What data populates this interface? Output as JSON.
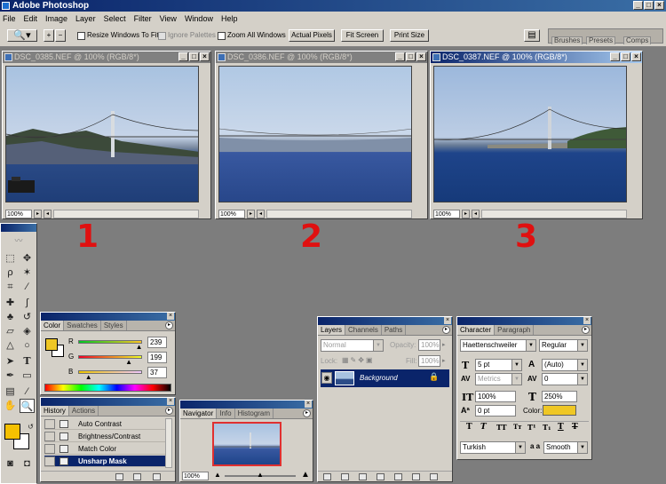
{
  "app": {
    "title": "Adobe Photoshop"
  },
  "menu": [
    "File",
    "Edit",
    "Image",
    "Layer",
    "Select",
    "Filter",
    "View",
    "Window",
    "Help"
  ],
  "options": {
    "resize_windows": "Resize Windows To Fit",
    "ignore_palettes": "Ignore Palettes",
    "zoom_all_windows": "Zoom All Windows",
    "actual_pixels": "Actual Pixels",
    "fit_screen": "Fit Screen",
    "print_size": "Print Size"
  },
  "palette_well": {
    "tabs": [
      "Brushes",
      "Presets",
      "Comps"
    ]
  },
  "documents": [
    {
      "title": "DSC_0385.NEF @ 100% (RGB/8*)",
      "zoom": "100%",
      "label": "1",
      "active": false
    },
    {
      "title": "DSC_0386.NEF @ 100% (RGB/8*)",
      "zoom": "100%",
      "label": "2",
      "active": false
    },
    {
      "title": "DSC_0387.NEF @ 100% (RGB/8*)",
      "zoom": "100%",
      "label": "3",
      "active": true
    }
  ],
  "color_panel": {
    "tabs": [
      "Color",
      "Swatches",
      "Styles"
    ],
    "r_label": "R",
    "g_label": "G",
    "b_label": "B",
    "r": "239",
    "g": "199",
    "b": "37",
    "r_level": 0.94,
    "g_level": 0.78,
    "b_level": 0.15,
    "fg_color": "#efc725"
  },
  "history_panel": {
    "tabs": [
      "History",
      "Actions"
    ],
    "items": [
      {
        "label": "Auto Contrast",
        "selected": false
      },
      {
        "label": "Brightness/Contrast",
        "selected": false
      },
      {
        "label": "Match Color",
        "selected": false
      },
      {
        "label": "Unsharp Mask",
        "selected": true
      }
    ]
  },
  "navigator_panel": {
    "tabs": [
      "Navigator",
      "Info",
      "Histogram"
    ],
    "zoom": "100%",
    "zoom_level": 0.5
  },
  "layers_panel": {
    "tabs": [
      "Layers",
      "Channels",
      "Paths"
    ],
    "blend_mode": "Normal",
    "opacity_label": "Opacity:",
    "opacity": "100%",
    "lock_label": "Lock:",
    "fill_label": "Fill:",
    "fill": "100%",
    "layer_name": "Background"
  },
  "character_panel": {
    "tabs": [
      "Character",
      "Paragraph"
    ],
    "font_family": "Haettenschweiler",
    "font_style": "Regular",
    "size": "5 pt",
    "leading": "(Auto)",
    "kerning": "Metrics",
    "tracking": "0",
    "vscale": "100%",
    "hscale": "250%",
    "baseline": "0 pt",
    "color_label": "Color:",
    "text_color": "#efc725",
    "language": "Turkish",
    "aa_label": "a a",
    "antialias": "Smooth"
  },
  "toolbox": {
    "fg_color": "#f5c000",
    "bg_color": "#ffffff"
  }
}
